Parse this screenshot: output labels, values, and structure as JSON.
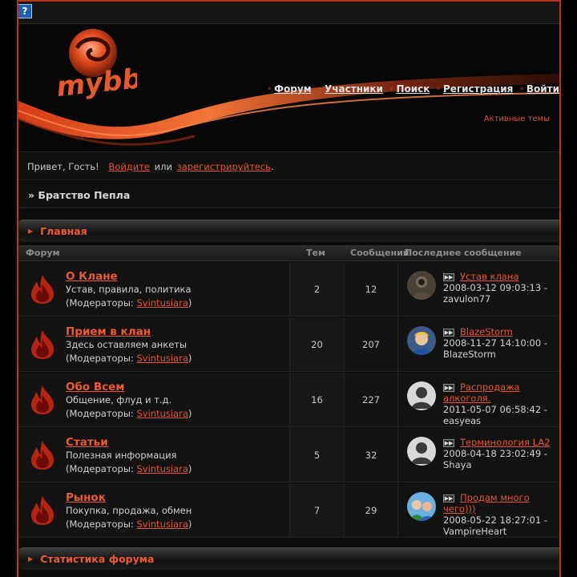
{
  "topbar": {
    "help_icon": "?"
  },
  "logo": {
    "text": "mybb",
    "icon": "mybb-swirl-logo"
  },
  "nav": [
    {
      "label": "Форум"
    },
    {
      "label": "Участники"
    },
    {
      "label": "Поиск"
    },
    {
      "label": "Регистрация"
    },
    {
      "label": "Войти"
    }
  ],
  "active_topics": "Активные темы",
  "greeting": {
    "prefix": "Привет, Гость!",
    "login": "Войдите",
    "or": "или",
    "register": "зарегистрируйтесь",
    "suffix": "."
  },
  "breadcrumb": "» Братство Пепла",
  "category_main": "Главная",
  "columns": {
    "forum": "Форум",
    "topics": "Тем",
    "posts": "Сообщений",
    "last": "Последнее сообщение"
  },
  "mods_prefix": "(Модераторы:",
  "mods_suffix": ")",
  "forums": [
    {
      "name": "О Клане",
      "desc": "Устав, правила, политика",
      "mod": "Svintusiara",
      "topics": "2",
      "posts": "12",
      "last_title": "Устав клана",
      "last_date": "2008-03-12 09:03:13 -",
      "last_user": "zavulon77",
      "avatar": "armored-figure"
    },
    {
      "name": "Прием в клан",
      "desc": "Здесь оставляем анкеты",
      "mod": "Svintusiara",
      "topics": "20",
      "posts": "207",
      "last_title": "BlazeStorm",
      "last_date": "2008-11-27 14:10:00 -",
      "last_user": "BlazeStorm",
      "avatar": "blond-boy"
    },
    {
      "name": "Обо Всем",
      "desc": "Общение, флуд и т.д.",
      "mod": "Svintusiara",
      "topics": "16",
      "posts": "227",
      "last_title": "Распродажа алкоголя.",
      "last_date": "2011-05-07 06:58:42 -",
      "last_user": "easyeas",
      "avatar": "default-user"
    },
    {
      "name": "Статьи",
      "desc": "Полезная информация",
      "mod": "Svintusiara",
      "topics": "5",
      "posts": "32",
      "last_title": "Терминология LA2",
      "last_date": "2008-04-18 23:02:49 -",
      "last_user": "Shaya",
      "avatar": "default-user"
    },
    {
      "name": "Рынок",
      "desc": "Покупка, продажа, обмен",
      "mod": "Svintusiara",
      "topics": "7",
      "posts": "29",
      "last_title": "Продам много чего)))",
      "last_date": "2008-05-22 18:27:01 -",
      "last_user": "VampireHeart",
      "avatar": "two-people"
    }
  ],
  "category_stats": "Статистика форума",
  "colors": {
    "accent": "#ef5a2c",
    "border": "#b8341a",
    "bg": "#0c0c0c"
  }
}
